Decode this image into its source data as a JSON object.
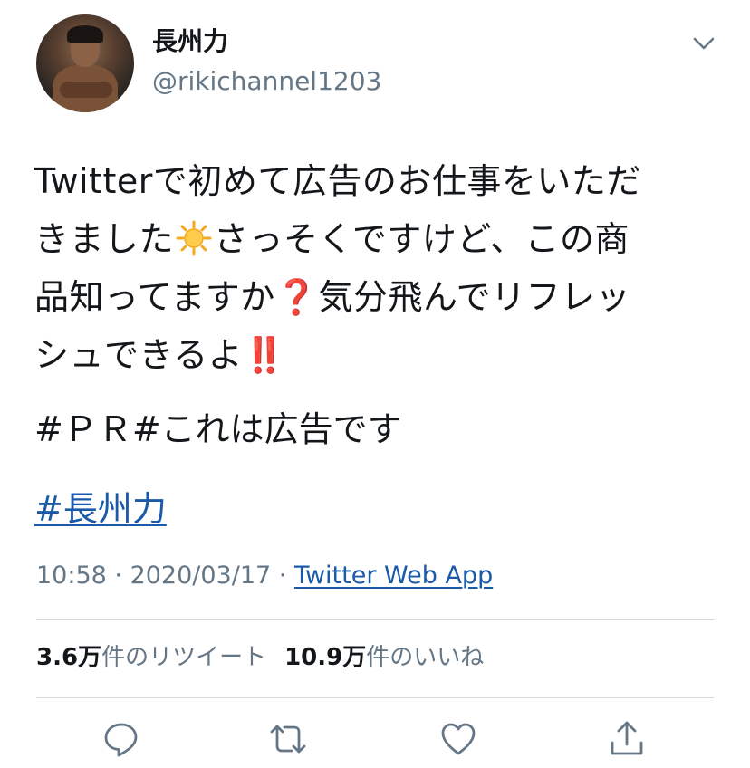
{
  "user": {
    "display_name": "長州力",
    "handle": "@rikichannel1203"
  },
  "tweet": {
    "line1": "Twitterで初めて広告のお仕事をいただ",
    "line2_a": "きました",
    "line2_emoji": "sun-emoji",
    "line2_b": "さっそくですけど、この商",
    "line3_a": "品知ってますか",
    "line3_emoji": "❓",
    "line3_b": "気分飛んでリフレッ",
    "line4_a": "シュできるよ",
    "line4_emoji": "‼️",
    "hashtags_text": "#ＰＲ#これは広告です",
    "hashtag_link": "#長州力"
  },
  "meta": {
    "time": "10:58",
    "sep1": " · ",
    "date": "2020/03/17",
    "sep2": " · ",
    "source": "Twitter Web App"
  },
  "stats": {
    "retweets_count": "3.6万",
    "retweets_label": "件のリツイート",
    "likes_count": "10.9万",
    "likes_label": "件のいいね"
  },
  "actions": {
    "reply_icon": "reply-icon",
    "retweet_icon": "retweet-icon",
    "like_icon": "heart-icon",
    "share_icon": "share-icon"
  },
  "colors": {
    "link": "#1b5aa8",
    "secondary_text": "#657786",
    "icon": "#657786",
    "emoji_red": "#dd2e44"
  }
}
